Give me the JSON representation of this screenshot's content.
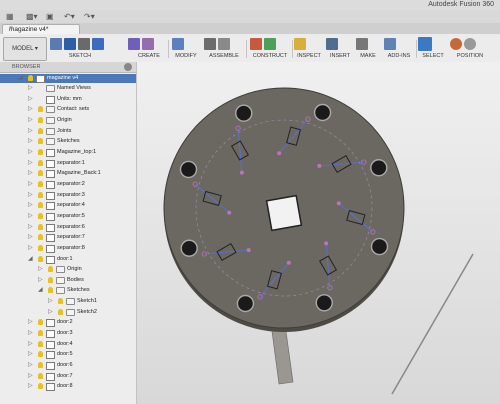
{
  "window": {
    "title": "Autodesk Fusion 360"
  },
  "tab": {
    "label": "magazine v4*"
  },
  "toolbar": {
    "mode": "MODEL",
    "groups": [
      "SKETCH",
      "CREATE",
      "MODIFY",
      "ASSEMBLE",
      "CONSTRUCT",
      "INSPECT",
      "INSERT",
      "MAKE",
      "ADD-INS",
      "SELECT",
      "POSITION"
    ]
  },
  "browser": {
    "header": "BROWSER",
    "root": "magazine v4",
    "items": [
      {
        "label": "Named Views",
        "indent": 1,
        "kind": "folder",
        "bulb": false
      },
      {
        "label": "Units: mm",
        "indent": 1,
        "kind": "doc",
        "bulb": false
      },
      {
        "label": "Contact: sets",
        "indent": 1,
        "kind": "folder",
        "bulb": true
      },
      {
        "label": "Origin",
        "indent": 1,
        "kind": "folder",
        "bulb": true
      },
      {
        "label": "Joints",
        "indent": 1,
        "kind": "folder",
        "bulb": true
      },
      {
        "label": "Sketches",
        "indent": 1,
        "kind": "folder",
        "bulb": true
      },
      {
        "label": "Magazine_top:1",
        "indent": 1,
        "kind": "comp",
        "bulb": true
      },
      {
        "label": "separator:1",
        "indent": 1,
        "kind": "comp",
        "bulb": true
      },
      {
        "label": "Magazine_Back:1",
        "indent": 1,
        "kind": "comp",
        "bulb": true
      },
      {
        "label": "separator:2",
        "indent": 1,
        "kind": "comp",
        "bulb": true
      },
      {
        "label": "separator:3",
        "indent": 1,
        "kind": "comp",
        "bulb": true
      },
      {
        "label": "separator:4",
        "indent": 1,
        "kind": "comp",
        "bulb": true
      },
      {
        "label": "separator:5",
        "indent": 1,
        "kind": "comp",
        "bulb": true
      },
      {
        "label": "separator:6",
        "indent": 1,
        "kind": "comp",
        "bulb": true
      },
      {
        "label": "separator:7",
        "indent": 1,
        "kind": "comp",
        "bulb": true
      },
      {
        "label": "separator:8",
        "indent": 1,
        "kind": "comp",
        "bulb": true
      },
      {
        "label": "door:1",
        "indent": 1,
        "kind": "comp",
        "bulb": true,
        "open": true
      },
      {
        "label": "Origin",
        "indent": 2,
        "kind": "folder",
        "bulb": true
      },
      {
        "label": "Bodies",
        "indent": 2,
        "kind": "folder",
        "bulb": true
      },
      {
        "label": "Sketches",
        "indent": 2,
        "kind": "folder",
        "bulb": true,
        "open": true
      },
      {
        "label": "Sketch1",
        "indent": 3,
        "kind": "sketch",
        "bulb": true
      },
      {
        "label": "Sketch2",
        "indent": 3,
        "kind": "sketch",
        "bulb": true
      },
      {
        "label": "door:2",
        "indent": 1,
        "kind": "comp",
        "bulb": true
      },
      {
        "label": "door:3",
        "indent": 1,
        "kind": "comp",
        "bulb": true
      },
      {
        "label": "door:4",
        "indent": 1,
        "kind": "comp",
        "bulb": true
      },
      {
        "label": "door:5",
        "indent": 1,
        "kind": "comp",
        "bulb": true
      },
      {
        "label": "door:6",
        "indent": 1,
        "kind": "comp",
        "bulb": true
      },
      {
        "label": "door:7",
        "indent": 1,
        "kind": "comp",
        "bulb": true
      },
      {
        "label": "door:8",
        "indent": 1,
        "kind": "comp",
        "bulb": true
      }
    ]
  },
  "colors": {
    "disc": "#6b6862",
    "selection": "#4a78b8",
    "bulb": "#e8c020"
  }
}
